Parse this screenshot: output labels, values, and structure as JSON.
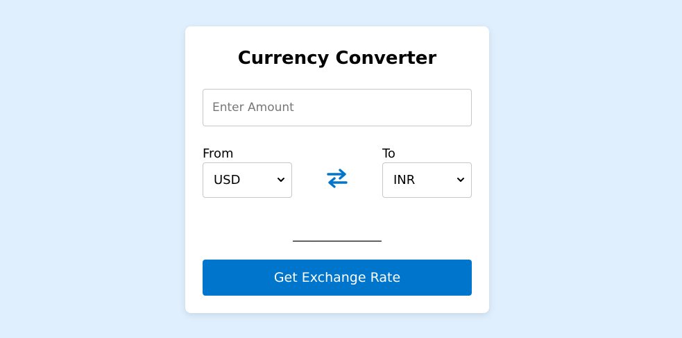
{
  "converter": {
    "title": "Currency Converter",
    "amount": {
      "value": "",
      "placeholder": "Enter Amount"
    },
    "from": {
      "label": "From",
      "selected": "USD"
    },
    "to": {
      "label": "To",
      "selected": "INR"
    },
    "swap_icon": "swap-arrows-icon",
    "result_text": "_______________",
    "button_label": "Get Exchange Rate"
  },
  "colors": {
    "page_background": "#dfeffd",
    "card_background": "#ffffff",
    "accent": "#0075cc",
    "border": "#c7c7c7"
  }
}
